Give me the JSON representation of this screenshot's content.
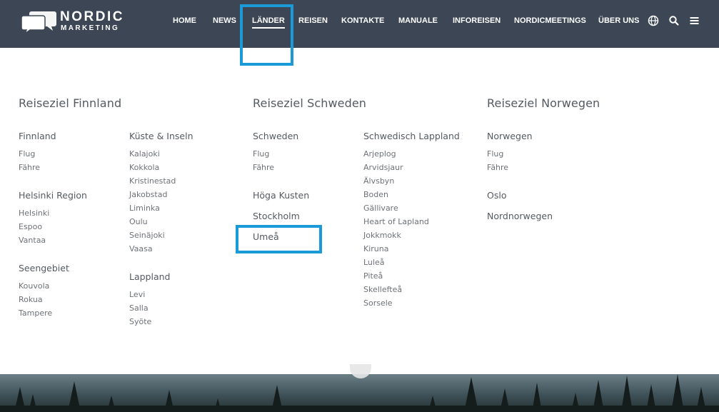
{
  "brand": {
    "line1": "NORDIC",
    "line2": "MARKETING"
  },
  "nav": {
    "items": [
      "HOME",
      "NEWS",
      "LÄNDER",
      "REISEN",
      "KONTAKTE",
      "MANUALE",
      "INFOREISEN",
      "NORDICMEETINGS",
      "ÜBER UNS"
    ],
    "active": "LÄNDER",
    "icons": [
      "globe-icon",
      "search-icon",
      "menu-icon"
    ]
  },
  "menu": {
    "finnland": {
      "title": "Reiseziel Finnland",
      "finnland": {
        "label": "Finnland",
        "links": [
          "Flug",
          "Fähre"
        ]
      },
      "helsinki": {
        "label": "Helsinki Region",
        "links": [
          "Helsinki",
          "Espoo",
          "Vantaa"
        ]
      },
      "seen": {
        "label": "Seengebiet",
        "links": [
          "Kouvola",
          "Rokua",
          "Tampere"
        ]
      },
      "kueste": {
        "label": "Küste & Inseln",
        "links": [
          "Kalajoki",
          "Kokkola",
          "Kristinestad",
          "Jakobstad",
          "Liminka",
          "Oulu",
          "Seinäjoki",
          "Vaasa"
        ]
      },
      "lappland": {
        "label": "Lappland",
        "links": [
          "Levi",
          "Salla",
          "Syöte"
        ]
      }
    },
    "schweden": {
      "title": "Reiseziel Schweden",
      "schweden": {
        "label": "Schweden",
        "links": [
          "Flug",
          "Fähre"
        ]
      },
      "hoga": {
        "label": "Höga Kusten"
      },
      "stockholm": {
        "label": "Stockholm"
      },
      "umea": {
        "label": "Umeå"
      },
      "lappland": {
        "label": "Schwedisch Lappland",
        "links": [
          "Arjeplog",
          "Arvidsjaur",
          "Älvsbyn",
          "Boden",
          "Gällivare",
          "Heart of Lapland",
          "Jokkmokk",
          "Kiruna",
          "Luleå",
          "Piteå",
          "Skellefteå",
          "Sorsele"
        ]
      }
    },
    "norwegen": {
      "title": "Reiseziel Norwegen",
      "norwegen": {
        "label": "Norwegen",
        "links": [
          "Flug",
          "Fähre"
        ]
      },
      "oslo": {
        "label": "Oslo"
      },
      "nord": {
        "label": "Nordnorwegen"
      }
    }
  },
  "colors": {
    "header_bg": "#3c4654",
    "highlight": "#1a9ad6"
  }
}
